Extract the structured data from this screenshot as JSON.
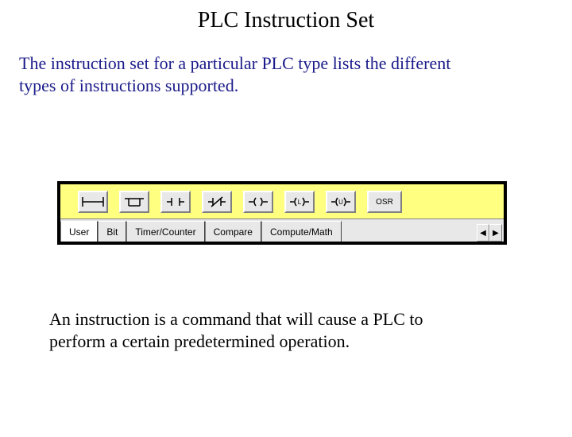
{
  "title": "PLC Instruction Set",
  "intro": "The instruction set for a particular PLC type lists the different types of instructions supported.",
  "footnote": "An instruction is a command that will cause a PLC to perform a certain predetermined operation.",
  "toolbar": {
    "osr_label": "OSR",
    "icons": [
      "rung-icon",
      "branch-icon",
      "xic-icon",
      "xio-icon",
      "ote-icon",
      "otl-icon",
      "otu-icon",
      "osr-icon"
    ]
  },
  "tabs": {
    "items": [
      "User",
      "Bit",
      "Timer/Counter",
      "Compare",
      "Compute/Math"
    ],
    "active_index": 0
  },
  "arrows": {
    "left": "◀",
    "right": "▶"
  }
}
